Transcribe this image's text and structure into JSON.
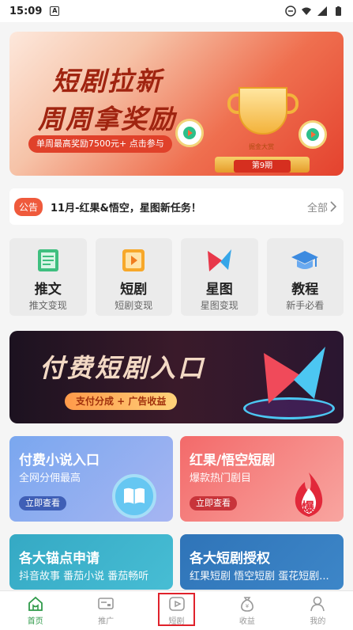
{
  "status_bar": {
    "time": "15:09",
    "app_badge": "A"
  },
  "banner_top": {
    "line1": "短剧拉新",
    "line2": "周周拿奖励",
    "pill": "单周最高奖励7500元+ 点击参与",
    "trophy_label": "掘金大赏",
    "ribbon": "第9期"
  },
  "notice": {
    "badge": "公告",
    "text": "11月-红果&悟空，星图新任务！",
    "all": "全部"
  },
  "tiles": [
    {
      "title": "推文",
      "sub": "推文变现",
      "icon": "book-icon"
    },
    {
      "title": "短剧",
      "sub": "短剧变现",
      "icon": "film-icon"
    },
    {
      "title": "星图",
      "sub": "星图变现",
      "icon": "star-map-icon"
    },
    {
      "title": "教程",
      "sub": "新手必看",
      "icon": "graduation-cap-icon"
    }
  ],
  "banner_pay": {
    "title": "付费短剧入口",
    "pill": "支付分成 + 广告收益"
  },
  "cards": {
    "novel": {
      "title": "付费小说入口",
      "sub": "全网分佣最高",
      "btn": "立即查看"
    },
    "hongguo": {
      "title": "红果/悟空短剧",
      "sub": "爆款热门剧目",
      "btn": "立即查看",
      "badge": "爆"
    },
    "anchor": {
      "title": "各大锚点申请",
      "sub": "抖音故事 番茄小说 番茄畅听"
    },
    "auth": {
      "title": "各大短剧授权",
      "sub": "红果短剧 悟空短剧 蛋花短剧..."
    }
  },
  "nav": [
    {
      "label": "首页",
      "icon": "home-icon",
      "active": true
    },
    {
      "label": "推广",
      "icon": "promote-icon",
      "active": false
    },
    {
      "label": "短剧",
      "icon": "play-icon",
      "active": false
    },
    {
      "label": "收益",
      "icon": "money-bag-icon",
      "active": false
    },
    {
      "label": "我的",
      "icon": "user-icon",
      "active": false
    }
  ],
  "colors": {
    "accent_green": "#2f9a4a",
    "notice_red": "#ef5a3c",
    "highlight_red": "#e0222b"
  }
}
